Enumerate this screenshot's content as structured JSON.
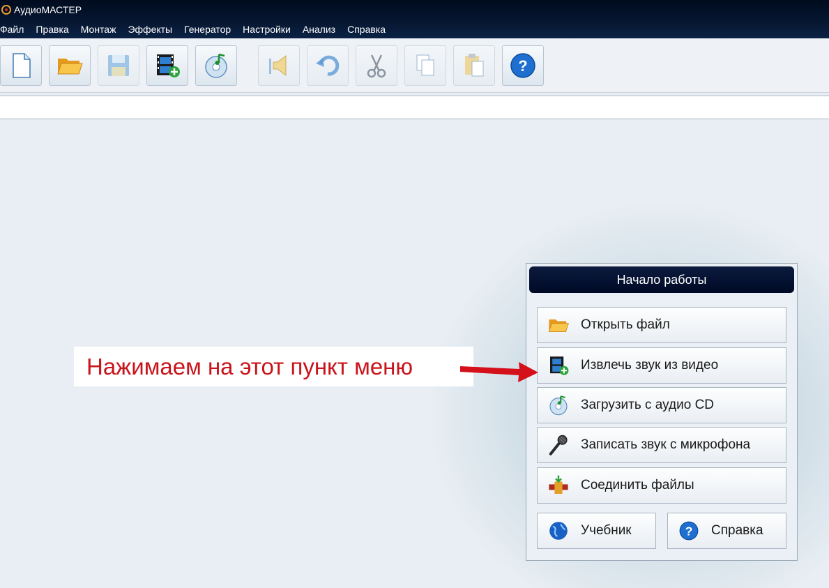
{
  "window": {
    "title": "АудиоМАСТЕР"
  },
  "menu": [
    "Файл",
    "Правка",
    "Монтаж",
    "Эффекты",
    "Генератор",
    "Настройки",
    "Анализ",
    "Справка"
  ],
  "toolbar": {
    "buttons": [
      {
        "icon": "new-file-icon"
      },
      {
        "icon": "open-folder-icon"
      },
      {
        "icon": "save-icon"
      },
      {
        "icon": "video-add-icon"
      },
      {
        "icon": "audio-cd-icon"
      },
      {
        "icon": "speaker-icon"
      },
      {
        "icon": "undo-icon"
      },
      {
        "icon": "cut-icon"
      },
      {
        "icon": "copy-icon"
      },
      {
        "icon": "paste-icon"
      },
      {
        "icon": "help-icon"
      }
    ]
  },
  "start_panel": {
    "title": "Начало работы",
    "buttons": [
      {
        "label": "Открыть файл",
        "icon": "open-folder-icon"
      },
      {
        "label": "Извлечь звук из видео",
        "icon": "video-add-icon"
      },
      {
        "label": "Загрузить с аудио CD",
        "icon": "audio-cd-icon"
      },
      {
        "label": "Записать звук с микрофона",
        "icon": "microphone-icon"
      },
      {
        "label": "Соединить файлы",
        "icon": "join-files-icon"
      },
      {
        "label": "Учебник",
        "icon": "globe-icon"
      },
      {
        "label": "Справка",
        "icon": "help-icon"
      }
    ]
  },
  "annotation": {
    "text": "Нажимаем на этот пункт меню",
    "color": "#c8141a"
  }
}
